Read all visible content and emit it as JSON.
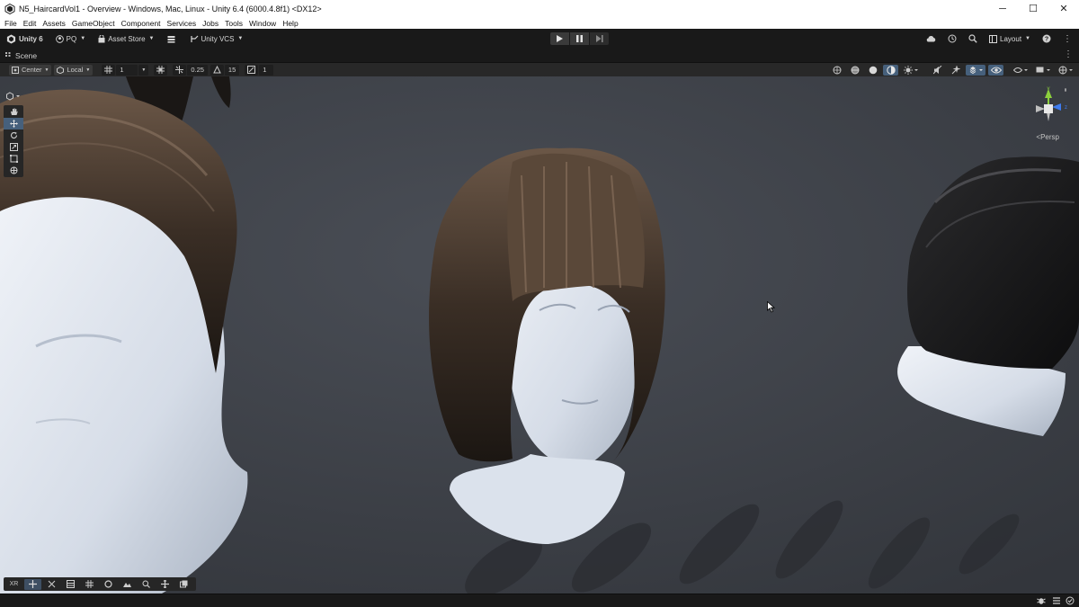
{
  "window": {
    "title": "N5_HaircardVol1 - Overview - Windows, Mac, Linux - Unity 6.4 (6000.4.8f1) <DX12>",
    "minimize_glyph": "─",
    "maximize_glyph": "☐",
    "close_glyph": "✕"
  },
  "menu": [
    "File",
    "Edit",
    "Assets",
    "GameObject",
    "Component",
    "Services",
    "Jobs",
    "Tools",
    "Window",
    "Help"
  ],
  "toolbar": {
    "unity_label": "Unity 6",
    "account_label": "PQ",
    "asset_store_label": "Asset Store",
    "vcs_label": "Unity VCS",
    "layout_label": "Layout"
  },
  "scene_tab": {
    "label": "Scene"
  },
  "scene_toolbar": {
    "pivot_label": "Center",
    "space_label": "Local",
    "grid_value": "1",
    "snap_increment": "0.25",
    "rotate_snap": "15",
    "scale_snap": "1"
  },
  "gizmo": {
    "projection_label": "Persp",
    "projection_prefix": "<",
    "axis_y": "y",
    "axis_z": "z"
  },
  "overlay_toolbar": {
    "xr_label": "XR"
  },
  "colors": {
    "background": "#191919",
    "viewport": "#3c3f45",
    "active_button": "#46607c",
    "axis_x": "#e0513a",
    "axis_y": "#8ccf3d",
    "axis_z": "#3e7cf0"
  }
}
